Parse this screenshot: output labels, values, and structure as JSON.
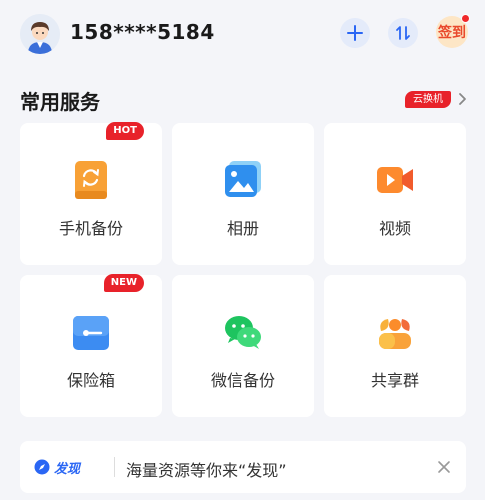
{
  "header": {
    "phone": "158****5184",
    "add_icon": "plus-icon",
    "transfer_icon": "transfer-arrows-icon",
    "signin_label": "签到",
    "signin_has_dot": true
  },
  "services": {
    "title": "常用服务",
    "tag": "云换机",
    "items": [
      {
        "label": "手机备份",
        "icon": "phone-backup-icon",
        "badge": "HOT"
      },
      {
        "label": "相册",
        "icon": "album-icon",
        "badge": ""
      },
      {
        "label": "视频",
        "icon": "video-icon",
        "badge": ""
      },
      {
        "label": "保险箱",
        "icon": "safe-box-icon",
        "badge": "NEW"
      },
      {
        "label": "微信备份",
        "icon": "wechat-backup-icon",
        "badge": ""
      },
      {
        "label": "共享群",
        "icon": "share-group-icon",
        "badge": ""
      }
    ]
  },
  "discover": {
    "logo_text": "发现",
    "message": "海量资源等你来“发现”",
    "close_icon": "close-icon"
  },
  "colors": {
    "accent_blue": "#2a66f4",
    "badge_red": "#e8222a",
    "background": "#f4f5f9"
  }
}
